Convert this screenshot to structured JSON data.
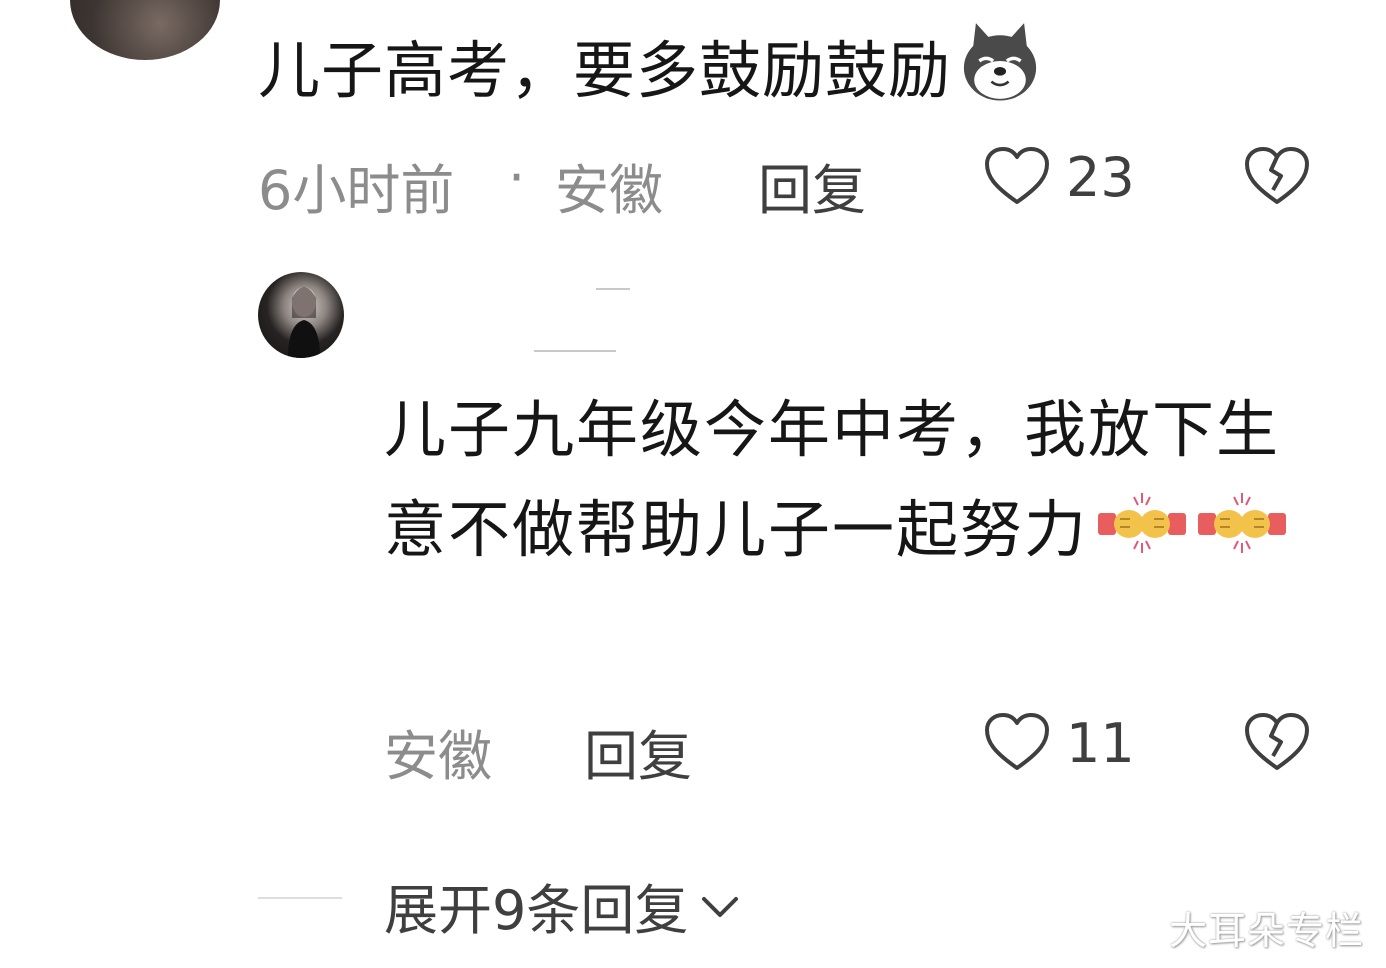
{
  "comment": {
    "text": "儿子高考，要多鼓励鼓励",
    "emoji": "dog-emoji",
    "time": "6小时前",
    "separator": "·",
    "location": "安徽",
    "reply_label": "回复",
    "like_count": "23"
  },
  "reply": {
    "text": "儿子九年级今年中考，我放下生意不做帮助儿子一起努力",
    "emoji": "fist-bump-emoji",
    "location": "安徽",
    "reply_label": "回复",
    "like_count": "11"
  },
  "expand": {
    "label": "展开9条回复"
  },
  "watermark": "大耳朵专栏",
  "colors": {
    "primary_text": "#161616",
    "meta_text": "#8c8c8c",
    "action_text": "#3f3f3f",
    "background": "#ffffff"
  }
}
